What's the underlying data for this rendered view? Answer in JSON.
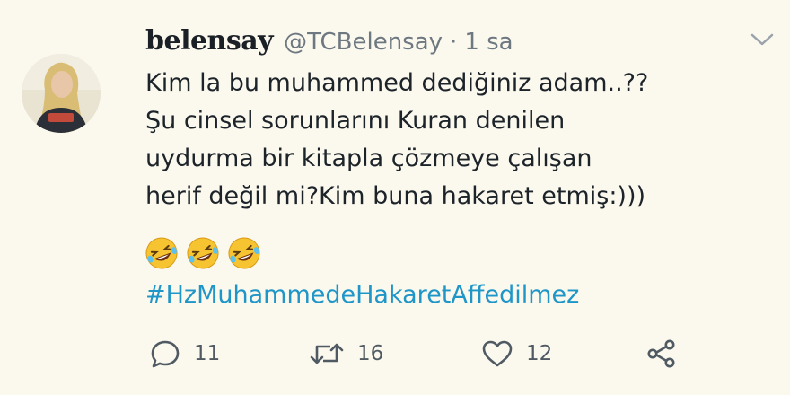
{
  "tweet": {
    "display_name": "belensay",
    "handle": "@TCBelensay",
    "separator": "·",
    "time": "1 sa",
    "lines": [
      "Kim la bu muhammed dediğiniz adam..??",
      "Şu cinsel sorunlarını Kuran denilen",
      "uydurma bir kitapla çözmeye çalışan",
      "herif değil mi?Kim buna hakaret etmiş:)))"
    ],
    "emojis": [
      "rolling-laughing-emoji",
      "rolling-laughing-emoji",
      "rolling-laughing-emoji"
    ],
    "hashtag": "#HzMuhammedeHakaretAffedilmez"
  },
  "actions": {
    "reply_count": "11",
    "retweet_count": "16",
    "like_count": "12"
  },
  "colors": {
    "background": "#fbf8ee",
    "text": "#1c2329",
    "muted": "#6e7880",
    "hashtag": "#1f96c8",
    "icon": "#4f5a62"
  }
}
